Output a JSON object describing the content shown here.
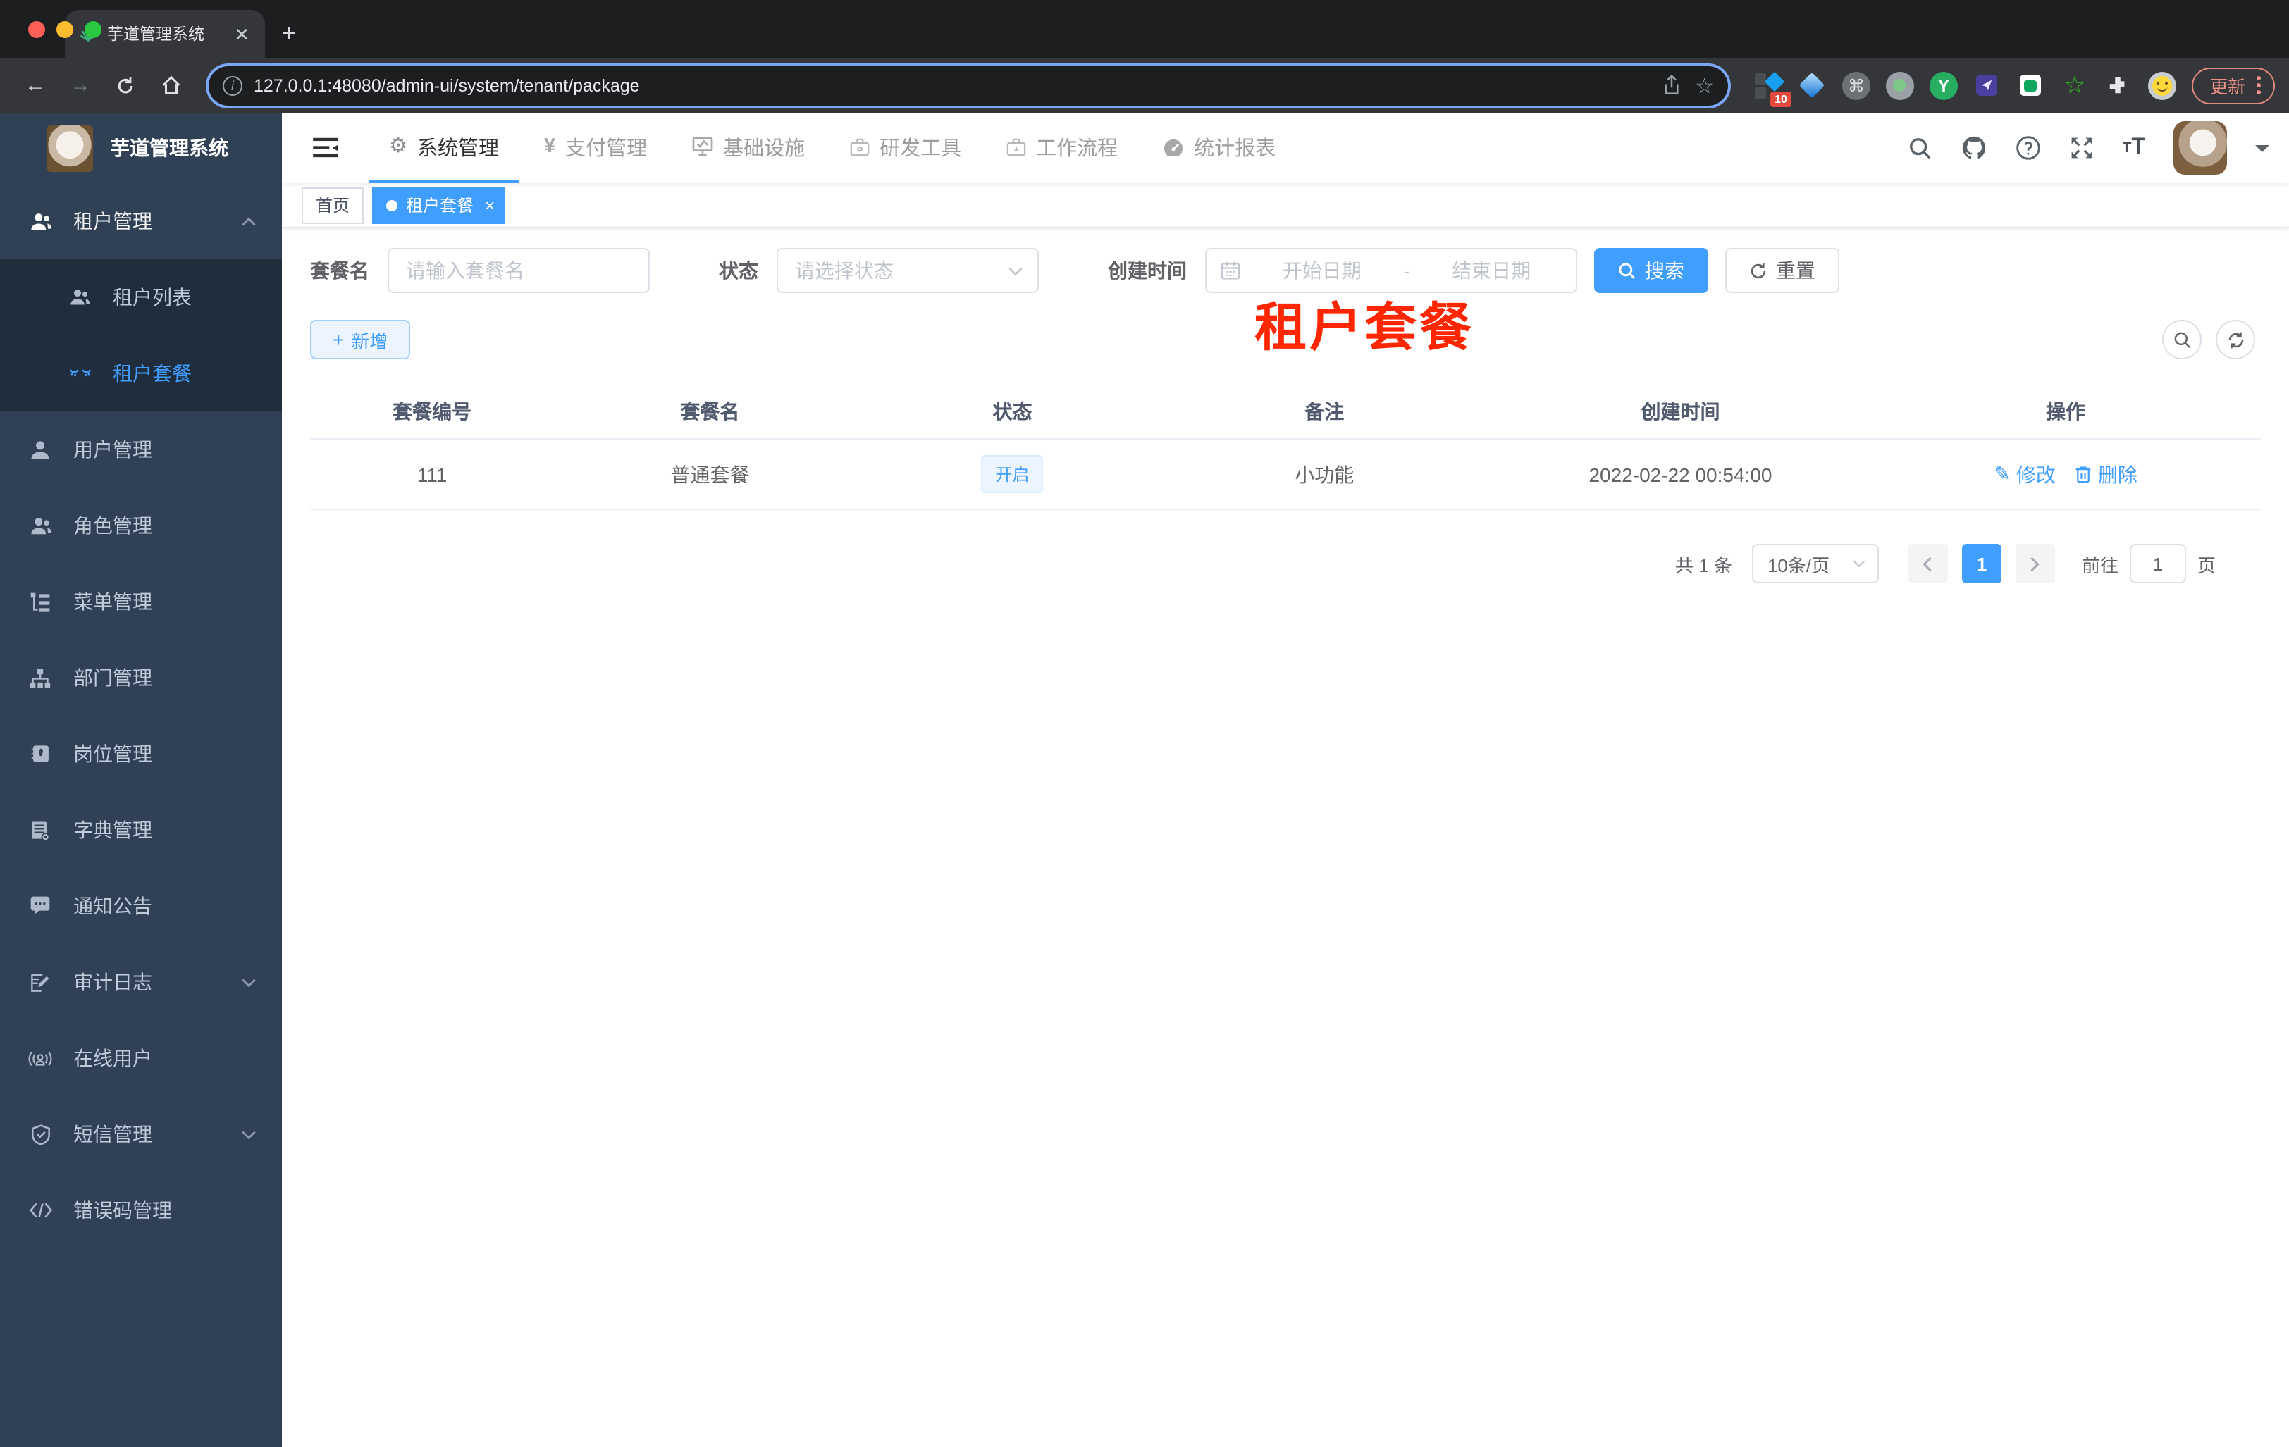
{
  "browser": {
    "tab_title": "芋道管理系统",
    "url": "127.0.0.1:48080/admin-ui/system/tenant/package",
    "update_label": "更新",
    "ext_badge": "10"
  },
  "annotation": {
    "text": "租户套餐",
    "color": "#ff2600"
  },
  "colors": {
    "accent": "#409eff",
    "sidebar_bg": "#304156",
    "submenu_bg": "#1f2d3d",
    "tag_active_bg": "#409eff",
    "status_tag_bg": "#ecf5ff"
  },
  "sidebar": {
    "logo_title": "芋道管理系统",
    "items": [
      {
        "label": "租户管理"
      },
      {
        "label": "租户列表"
      },
      {
        "label": "租户套餐"
      },
      {
        "label": "用户管理"
      },
      {
        "label": "角色管理"
      },
      {
        "label": "菜单管理"
      },
      {
        "label": "部门管理"
      },
      {
        "label": "岗位管理"
      },
      {
        "label": "字典管理"
      },
      {
        "label": "通知公告"
      },
      {
        "label": "审计日志"
      },
      {
        "label": "在线用户"
      },
      {
        "label": "短信管理"
      },
      {
        "label": "错误码管理"
      }
    ]
  },
  "topnav": {
    "items": [
      {
        "label": "系统管理"
      },
      {
        "label": "支付管理"
      },
      {
        "label": "基础设施"
      },
      {
        "label": "研发工具"
      },
      {
        "label": "工作流程"
      },
      {
        "label": "统计报表"
      }
    ]
  },
  "tags": {
    "home": "首页",
    "active": "租户套餐"
  },
  "filters": {
    "name_label": "套餐名",
    "name_placeholder": "请输入套餐名",
    "status_label": "状态",
    "status_placeholder": "请选择状态",
    "date_label": "创建时间",
    "date_start_placeholder": "开始日期",
    "date_separator": "-",
    "date_end_placeholder": "结束日期",
    "search_label": "搜索",
    "reset_label": "重置",
    "add_label": "新增"
  },
  "table": {
    "columns": [
      "套餐编号",
      "套餐名",
      "状态",
      "备注",
      "创建时间",
      "操作"
    ],
    "rows": [
      {
        "id": "111",
        "name": "普通套餐",
        "status": "开启",
        "remark": "小功能",
        "created": "2022-02-22 00:54:00",
        "edit_label": "修改",
        "delete_label": "删除"
      }
    ]
  },
  "pagination": {
    "total": "共 1 条",
    "page_size": "10条/页",
    "current": "1",
    "goto_label": "前往",
    "goto_value": "1",
    "page_label": "页"
  }
}
